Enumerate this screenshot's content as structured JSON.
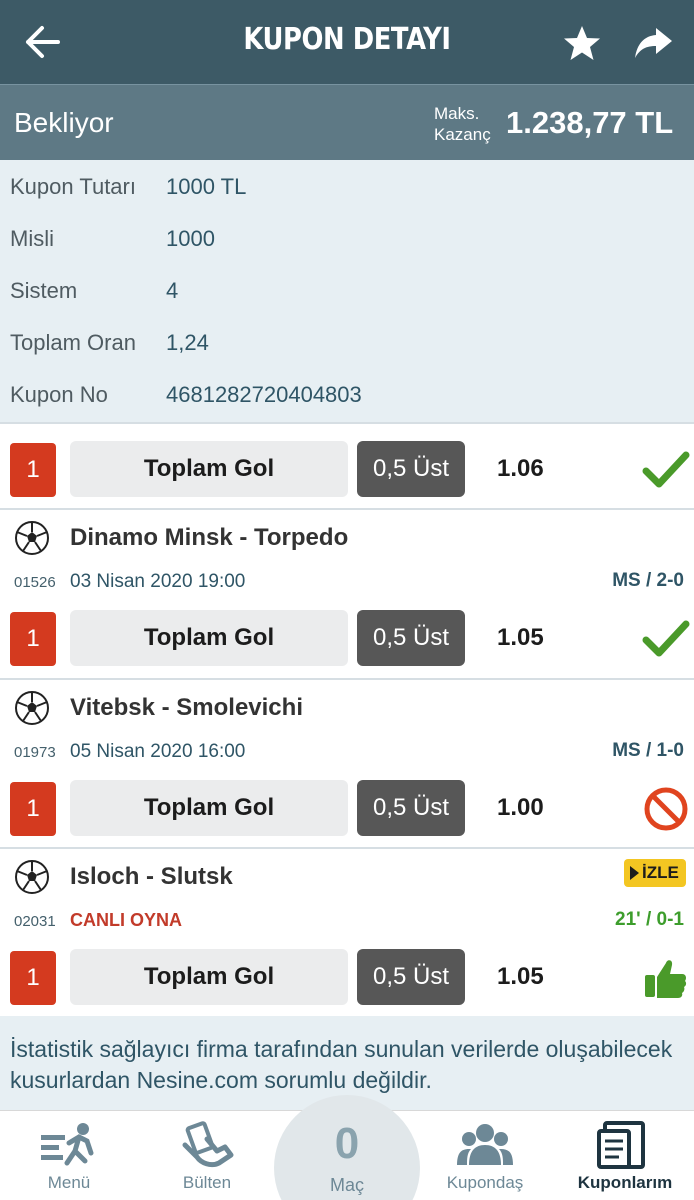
{
  "header": {
    "title": "KUPON DETAYI",
    "back_icon": "arrow-left-icon",
    "star_icon": "star-icon",
    "share_icon": "share-icon"
  },
  "status": {
    "label": "Bekliyor",
    "max_label_line1": "Maks.",
    "max_label_line2": "Kazanç",
    "max_amount": "1.238,77 TL"
  },
  "coupon": {
    "rows": [
      {
        "key": "Kupon Tutarı",
        "value": "1000 TL"
      },
      {
        "key": "Misli",
        "value": "1000"
      },
      {
        "key": "Sistem",
        "value": "4"
      },
      {
        "key": "Toplam Oran",
        "value": "1,24"
      },
      {
        "key": "Kupon No",
        "value": "4681282720404803"
      }
    ]
  },
  "bets": [
    {
      "has_match": false,
      "number": "1",
      "market": "Toplam Gol",
      "pick": "0,5 Üst",
      "odd": "1.06",
      "result": "won",
      "result_icon": "checkmark-icon"
    },
    {
      "has_match": true,
      "match": "Dinamo Minsk - Torpedo",
      "code": "01526",
      "date": "03 Nisan 2020 19:00",
      "score": "MS / 2-0",
      "number": "1",
      "market": "Toplam Gol",
      "pick": "0,5 Üst",
      "odd": "1.05",
      "result": "won",
      "result_icon": "checkmark-icon"
    },
    {
      "has_match": true,
      "match": "Vitebsk - Smolevichi",
      "code": "01973",
      "date": "05 Nisan 2020 16:00",
      "score": "MS / 1-0",
      "number": "1",
      "market": "Toplam Gol",
      "pick": "0,5 Üst",
      "odd": "1.00",
      "result": "void",
      "result_icon": "prohibited-icon"
    },
    {
      "has_match": true,
      "match": "Isloch - Slutsk",
      "code": "02031",
      "live_label": "CANLI OYNA",
      "live_badge": "İZLE",
      "score": "21' / 0-1",
      "number": "1",
      "market": "Toplam Gol",
      "pick": "0,5 Üst",
      "odd": "1.05",
      "result": "winning",
      "result_icon": "thumbs-up-icon"
    }
  ],
  "disclaimer": "İstatistik sağlayıcı firma tarafından sunulan verilerde oluşabilecek kusurlardan Nesine.com sorumlu değildir.",
  "tabbar": {
    "tabs": [
      {
        "label": "Menü",
        "icon": "menu-runner-icon"
      },
      {
        "label": "Bülten",
        "icon": "bulletin-hand-icon"
      },
      {
        "label": "Maç",
        "count": "0"
      },
      {
        "label": "Kupondaş",
        "icon": "group-users-icon"
      },
      {
        "label": "Kuponlarım",
        "icon": "coupons-icon",
        "active": true
      }
    ]
  },
  "colors": {
    "header_bg": "#3d5a66",
    "status_bg": "#5e7985",
    "info_bg": "#e7eff3",
    "number_red": "#d43a1f",
    "check_green": "#4a9a2a",
    "void_red": "#e0441f",
    "live_badge_yellow": "#f3c622"
  }
}
